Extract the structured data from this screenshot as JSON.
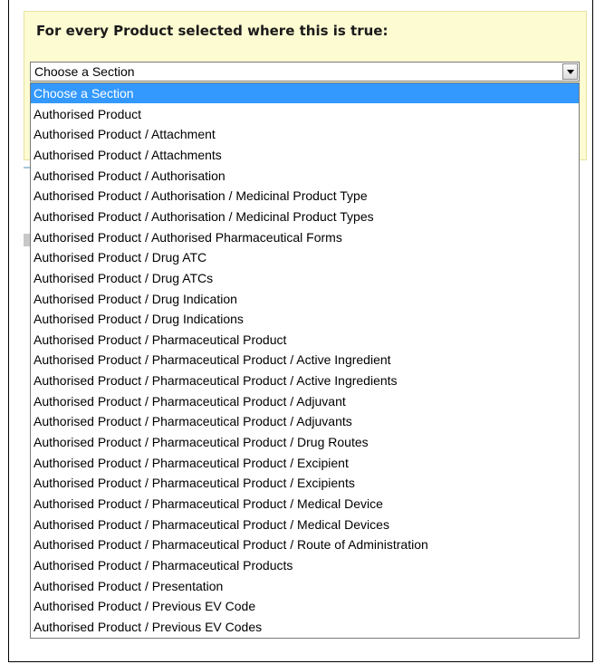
{
  "panel": {
    "title": "For every Product selected where this is true:"
  },
  "section_select": {
    "value": "Choose a Section",
    "options": [
      "Choose a Section",
      "Authorised Product",
      "Authorised Product / Attachment",
      "Authorised Product / Attachments",
      "Authorised Product / Authorisation",
      "Authorised Product / Authorisation / Medicinal Product Type",
      "Authorised Product / Authorisation / Medicinal Product Types",
      "Authorised Product / Authorised Pharmaceutical Forms",
      "Authorised Product / Drug ATC",
      "Authorised Product / Drug ATCs",
      "Authorised Product / Drug Indication",
      "Authorised Product / Drug Indications",
      "Authorised Product / Pharmaceutical Product",
      "Authorised Product / Pharmaceutical Product / Active Ingredient",
      "Authorised Product / Pharmaceutical Product / Active Ingredients",
      "Authorised Product / Pharmaceutical Product / Adjuvant",
      "Authorised Product / Pharmaceutical Product / Adjuvants",
      "Authorised Product / Pharmaceutical Product / Drug Routes",
      "Authorised Product / Pharmaceutical Product / Excipient",
      "Authorised Product / Pharmaceutical Product / Excipients",
      "Authorised Product / Pharmaceutical Product / Medical Device",
      "Authorised Product / Pharmaceutical Product / Medical Devices",
      "Authorised Product / Pharmaceutical Product / Route of Administration",
      "Authorised Product / Pharmaceutical Products",
      "Authorised Product / Presentation",
      "Authorised Product / Previous EV Code",
      "Authorised Product / Previous EV Codes"
    ],
    "highlighted": "Choose a Section"
  },
  "colors": {
    "panel_background": "#fdfbd2",
    "highlight": "#3399ff"
  },
  "icons": {
    "dropdown_arrow": "chevron-down-icon"
  }
}
